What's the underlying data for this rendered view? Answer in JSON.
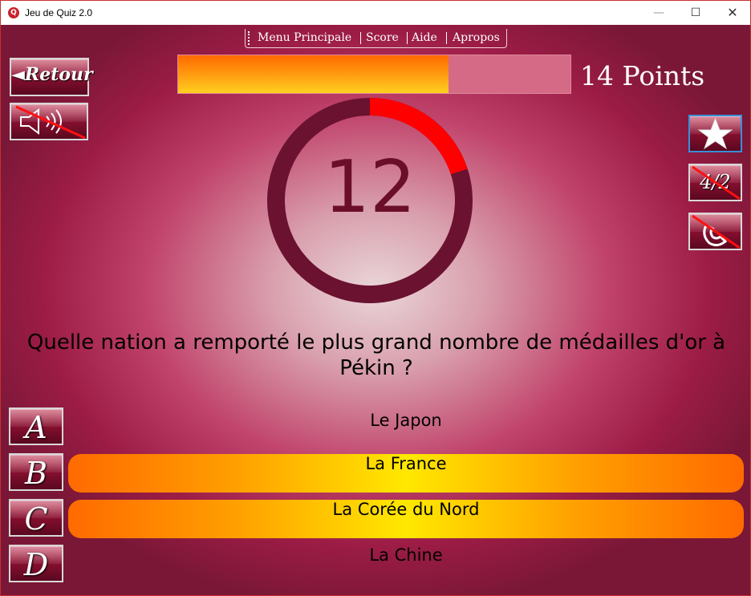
{
  "window": {
    "title": "Jeu de Quiz 2.0",
    "app_icon_letter": "Q",
    "minimize": "—",
    "maximize": "☐",
    "close": "✕"
  },
  "menu": {
    "items": [
      "Menu Principale",
      "Score",
      "Aide",
      "Apropos"
    ]
  },
  "retour_button": {
    "label": "◄Retour"
  },
  "sound_button": {
    "icon": "speaker-muted-icon"
  },
  "score": {
    "label": "14 Points",
    "progress_fraction": 0.69
  },
  "timer": {
    "value": "12",
    "remaining_fraction": 0.2
  },
  "question": "Quelle nation a remporté le plus grand nombre de médailles d'or à Pékin ?",
  "answers": [
    {
      "letter": "A",
      "text": "Le Japon",
      "highlighted": false
    },
    {
      "letter": "B",
      "text": "La France",
      "highlighted": true
    },
    {
      "letter": "C",
      "text": "La Corée du Nord",
      "highlighted": true
    },
    {
      "letter": "D",
      "text": "La Chine",
      "highlighted": false
    }
  ],
  "jokers": [
    {
      "name": "star-icon",
      "disabled": false
    },
    {
      "name": "fifty-fifty-icon",
      "label": "4/2",
      "disabled": true
    },
    {
      "name": "phone-icon",
      "disabled": true
    }
  ],
  "colors": {
    "timer_track": "#6a1230",
    "timer_arc": "#ff0000",
    "highlight": "#ffe800"
  }
}
